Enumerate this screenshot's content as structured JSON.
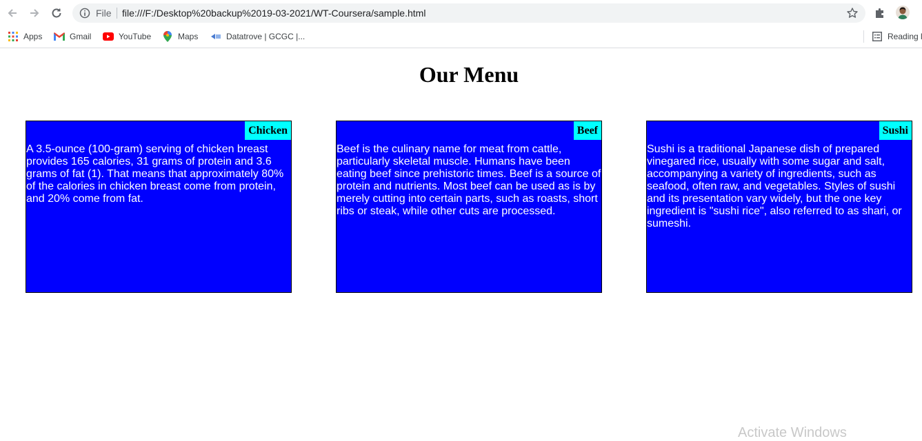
{
  "browser": {
    "omnibox": {
      "scheme_label": "File",
      "url": "file:///F:/Desktop%20backup%2019-03-2021/WT-Coursera/sample.html"
    },
    "bookmarks": [
      {
        "label": "Apps",
        "icon": "apps-grid-icon"
      },
      {
        "label": "Gmail",
        "icon": "gmail-icon"
      },
      {
        "label": "YouTube",
        "icon": "youtube-icon"
      },
      {
        "label": "Maps",
        "icon": "maps-pin-icon"
      },
      {
        "label": "Datatrove | GCGC |...",
        "icon": "datatrove-icon"
      }
    ],
    "reading_list_label": "Reading l"
  },
  "page": {
    "title": "Our Menu",
    "cards": [
      {
        "label": "Chicken",
        "text": "A 3.5-ounce (100-gram) serving of chicken breast provides 165 calories, 31 grams of protein and 3.6 grams of fat (1). That means that approximately 80% of the calories in chicken breast come from protein, and 20% come from fat."
      },
      {
        "label": "Beef",
        "text": "Beef is the culinary name for meat from cattle, particularly skeletal muscle. Humans have been eating beef since prehistoric times. Beef is a source of protein and nutrients. Most beef can be used as is by merely cutting into certain parts, such as roasts, short ribs or steak, while other cuts are processed."
      },
      {
        "label": "Sushi",
        "text": "Sushi is a traditional Japanese dish of prepared vinegared rice, usually with some sugar and salt, accompanying a variety of ingredients, such as seafood, often raw, and vegetables. Styles of sushi and its presentation vary widely, but the one key ingredient is \"sushi rice\", also referred to as shari, or sumeshi."
      }
    ]
  },
  "colors": {
    "card_background": "#0000ff",
    "label_background": "#00ffff",
    "card_text": "#ffffff"
  },
  "overlay": {
    "watermark": "Activate Windows"
  }
}
